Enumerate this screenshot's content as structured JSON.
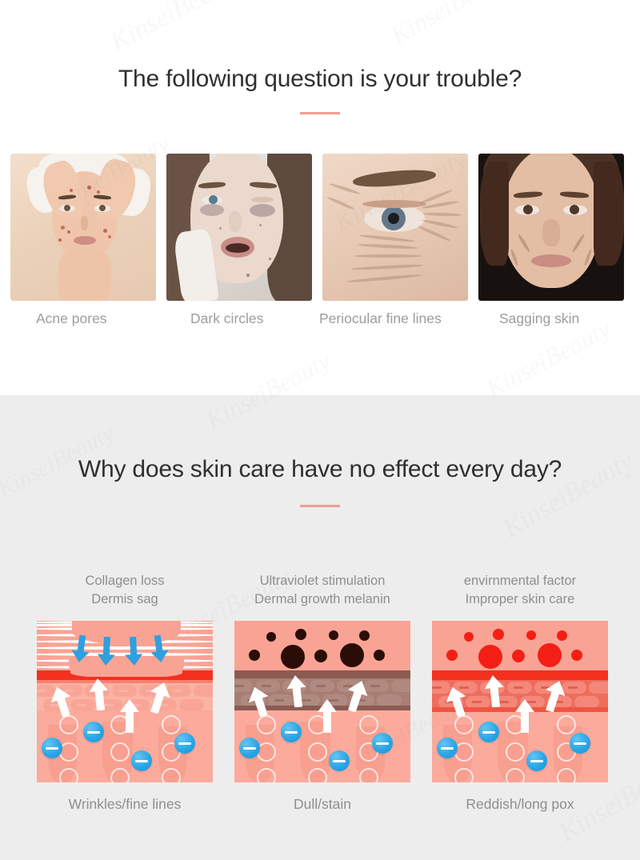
{
  "page": {
    "background_top": "#ffffff",
    "background_bottom": "#ededee",
    "accent_color": "#ef9e96",
    "heading_color": "#2f2f2f",
    "caption_color": "#9d9d9d",
    "watermark_text": "KinseiBeauty"
  },
  "section_one": {
    "heading": "The following question is your trouble?",
    "photos": [
      {
        "caption": "Acne pores",
        "alt": "woman with towel on head touching forehead with acne spots"
      },
      {
        "caption": "Dark circles",
        "alt": "young woman close-up with dark under-eye circles"
      },
      {
        "caption": "Periocular fine lines",
        "alt": "close-up of eye area with fine wrinkles"
      },
      {
        "caption": "Sagging skin",
        "alt": "mature woman face on dark background showing sagging skin"
      }
    ]
  },
  "section_two": {
    "heading": "Why does skin care have no effect every day?",
    "columns": [
      {
        "cause_line1": "Collagen loss",
        "cause_line2": "Dermis sag",
        "result": "Wrinkles/fine lines",
        "diagram": {
          "type": "sagging-collagen",
          "band_color": "#f4301f",
          "arrow_down_color": "#2f9fe0",
          "spots": "none",
          "wave_lines": 9,
          "down_arrows": 4,
          "up_arrows": 4,
          "ions": 5
        }
      },
      {
        "cause_line1": "Ultraviolet stimulation",
        "cause_line2": "Dermal growth melanin",
        "result": "Dull/stain",
        "diagram": {
          "type": "melanin-pigment",
          "band_color": "#8f5a50",
          "spot_color": "#2b0d08",
          "spots": 11,
          "up_arrows": 4,
          "ions": 5
        }
      },
      {
        "cause_line1": "envirnmental factor",
        "cause_line2": "Improper skin care",
        "result": "Reddish/long pox",
        "diagram": {
          "type": "redness-inflammation",
          "band_color": "#f4301f",
          "spot_color": "#f41f14",
          "spots": 11,
          "up_arrows": 4,
          "ions": 5
        }
      }
    ]
  }
}
